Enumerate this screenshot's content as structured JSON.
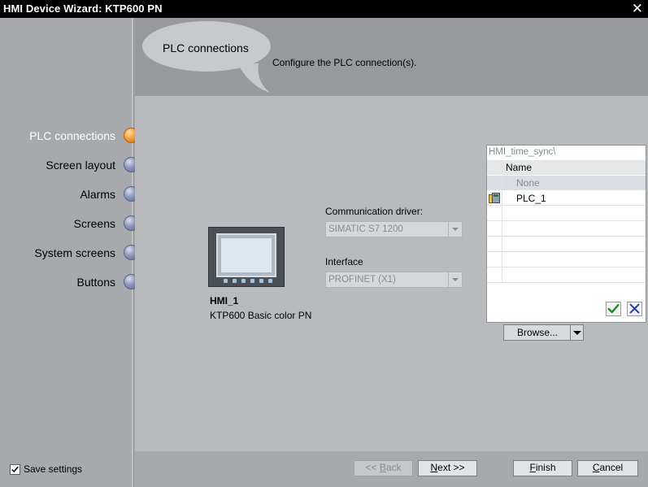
{
  "window": {
    "title": "HMI Device Wizard: KTP600 PN",
    "close_symbol": "✕"
  },
  "steps": [
    {
      "label": "PLC connections",
      "active": true
    },
    {
      "label": "Screen layout",
      "active": false
    },
    {
      "label": "Alarms",
      "active": false
    },
    {
      "label": "Screens",
      "active": false
    },
    {
      "label": "System screens",
      "active": false
    },
    {
      "label": "Buttons",
      "active": false
    }
  ],
  "header": {
    "title": "PLC connections",
    "description": "Configure the PLC connection(s)."
  },
  "device": {
    "name": "HMI_1",
    "type": "KTP600 Basic color PN"
  },
  "form": {
    "driver_label": "Communication driver:",
    "driver_value": "SIMATIC S7 1200",
    "interface_label": "Interface",
    "interface_value": "PROFINET (X1)"
  },
  "picker": {
    "path": "HMI_time_sync\\",
    "column_header": "Name",
    "rows": [
      {
        "label": "None",
        "selected": true,
        "icon": ""
      },
      {
        "label": "PLC_1",
        "selected": false,
        "icon": "plc-station-icon"
      }
    ],
    "ok_icon": "checkmark-icon",
    "cancel_icon": "x-icon"
  },
  "browse": {
    "label": "Browse..."
  },
  "footer": {
    "save_settings": "Save settings",
    "save_checked": true,
    "back": {
      "pre": "<< ",
      "mnemonic": "B",
      "post": "ack"
    },
    "next": {
      "pre": "",
      "mnemonic": "N",
      "post": "ext >>"
    },
    "finish": {
      "pre": "",
      "mnemonic": "F",
      "post": "inish"
    },
    "cancel": {
      "pre": "",
      "mnemonic": "C",
      "post": "ancel"
    }
  },
  "colors": {
    "accent_active": "#f59a2a",
    "step_inactive": "#8b97b9",
    "checkmark": "#1d8a2a",
    "cancel_x": "#1f3fa6"
  }
}
